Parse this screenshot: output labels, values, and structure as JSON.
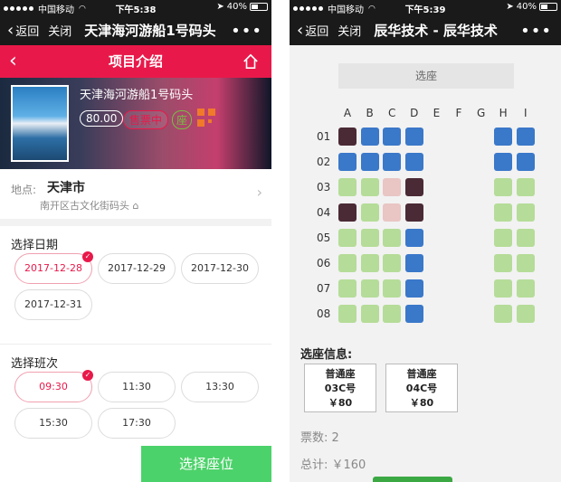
{
  "left": {
    "status": {
      "carrier": "中国移动",
      "time": "下午5:38",
      "battery": "40%"
    },
    "nav": {
      "back": "返回",
      "close": "关闭",
      "title": "天津海河游船1号码头",
      "more": "•••"
    },
    "subnav": {
      "title": "项目介绍",
      "back_icon": "chevron-left-icon",
      "home_icon": "home-icon"
    },
    "banner": {
      "title": "天津海河游船1号码头",
      "price": "80.00",
      "status": "售票中",
      "seat_tag": "座"
    },
    "address": {
      "label": "地点:",
      "city": "天津市",
      "street": "南开区古文化街码头"
    },
    "dates": {
      "title": "选择日期",
      "items": [
        {
          "label": "2017-12-28",
          "selected": true
        },
        {
          "label": "2017-12-29",
          "selected": false
        },
        {
          "label": "2017-12-30",
          "selected": false
        },
        {
          "label": "2017-12-31",
          "selected": false
        }
      ]
    },
    "times": {
      "title": "选择班次",
      "items": [
        {
          "label": "09:30",
          "selected": true
        },
        {
          "label": "11:30",
          "selected": false
        },
        {
          "label": "13:30",
          "selected": false
        },
        {
          "label": "15:30",
          "selected": false
        },
        {
          "label": "17:30",
          "selected": false
        }
      ]
    },
    "action": "选择座位",
    "colors": {
      "accent": "#e8194a",
      "green": "#4cd26a"
    }
  },
  "right": {
    "status": {
      "carrier": "中国移动",
      "time": "下午5:39",
      "battery": "40%"
    },
    "nav": {
      "back": "返回",
      "close": "关闭",
      "title": "辰华技术 - 辰华技术",
      "more": "•••"
    },
    "screen_label": "选座",
    "columns": [
      "A",
      "B",
      "C",
      "D",
      "E",
      "F",
      "G",
      "H",
      "I"
    ],
    "rows": [
      {
        "label": "01",
        "seats": [
          "sold",
          "avail",
          "avail",
          "avail",
          "",
          "",
          "",
          "avail",
          "avail"
        ]
      },
      {
        "label": "02",
        "seats": [
          "avail",
          "avail",
          "avail",
          "avail",
          "",
          "",
          "",
          "avail",
          "avail"
        ]
      },
      {
        "label": "03",
        "seats": [
          "free",
          "free",
          "chosen",
          "sold",
          "",
          "",
          "",
          "free",
          "free"
        ]
      },
      {
        "label": "04",
        "seats": [
          "sold",
          "free",
          "chosen",
          "sold",
          "",
          "",
          "",
          "free",
          "free"
        ]
      },
      {
        "label": "05",
        "seats": [
          "free",
          "free",
          "free",
          "avail",
          "",
          "",
          "",
          "free",
          "free"
        ]
      },
      {
        "label": "06",
        "seats": [
          "free",
          "free",
          "free",
          "avail",
          "",
          "",
          "",
          "free",
          "free"
        ]
      },
      {
        "label": "07",
        "seats": [
          "free",
          "free",
          "free",
          "avail",
          "",
          "",
          "",
          "free",
          "free"
        ]
      },
      {
        "label": "08",
        "seats": [
          "free",
          "free",
          "free",
          "avail",
          "",
          "",
          "",
          "free",
          "free"
        ]
      }
    ],
    "seat_colors": {
      "sold": "#4a2a35",
      "avail": "#3a78c9",
      "free": "#b5dc98",
      "chosen": "#e9c5c4"
    },
    "info_title": "选座信息:",
    "tickets": [
      {
        "type": "普通座",
        "seat": "03C号",
        "price": "￥80"
      },
      {
        "type": "普通座",
        "seat": "04C号",
        "price": "￥80"
      }
    ],
    "count": "票数: 2",
    "total": "总计: ￥160"
  }
}
